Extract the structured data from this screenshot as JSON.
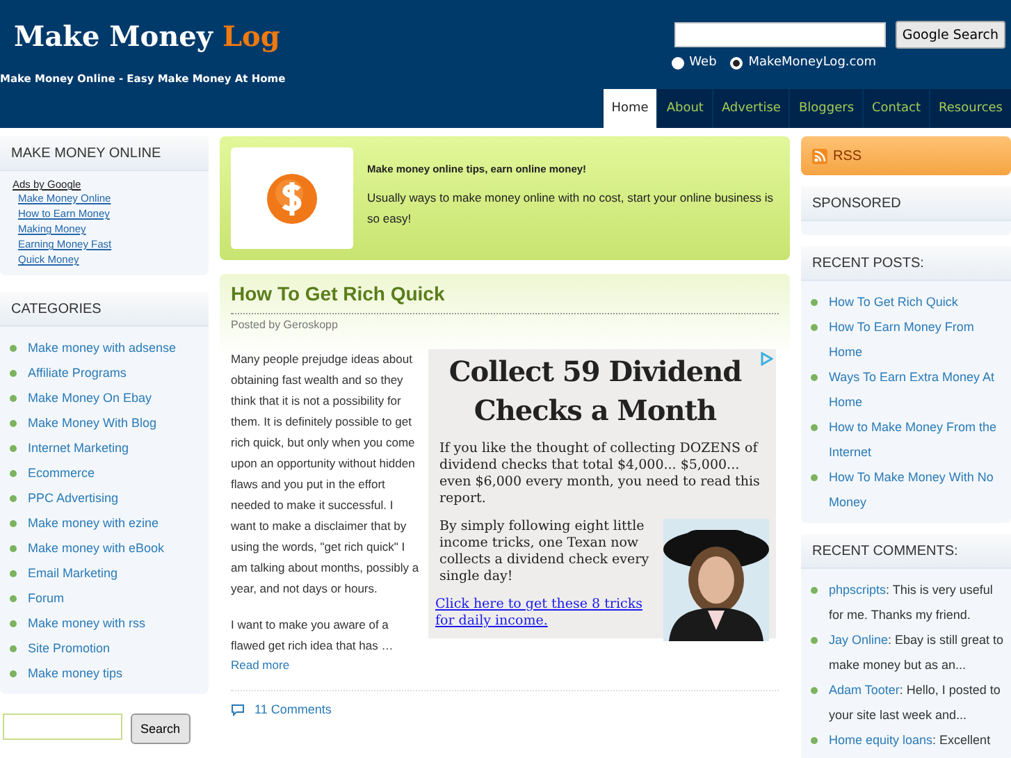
{
  "header": {
    "logo_main": "Make Money",
    "logo_accent": "Log",
    "tagline": "Make Money Online - Easy Make Money At Home",
    "search_button": "Google Search",
    "search_options": [
      {
        "label": "Web",
        "selected": false
      },
      {
        "label": "MakeMoneyLog.com",
        "selected": true
      }
    ]
  },
  "nav": [
    {
      "label": "Home",
      "selected": true
    },
    {
      "label": "About",
      "selected": false
    },
    {
      "label": "Advertise",
      "selected": false
    },
    {
      "label": "Bloggers",
      "selected": false
    },
    {
      "label": "Contact",
      "selected": false
    },
    {
      "label": "Resources",
      "selected": false
    }
  ],
  "left_sidebar": {
    "ads_title": "MAKE MONEY ONLINE",
    "ads_label": "Ads by Google",
    "ad_links": [
      "Make Money Online",
      "How to Earn Money",
      "Making Money",
      "Earning Money Fast",
      "Quick Money"
    ],
    "categories_title": "CATEGORIES",
    "categories": [
      "Make money with adsense",
      "Affiliate Programs",
      "Make Money On Ebay",
      "Make Money With Blog",
      "Internet Marketing",
      "Ecommerce",
      "PPC Advertising",
      "Make money with ezine",
      "Make money with eBook",
      "Email Marketing",
      "Forum",
      "Make money with rss",
      "Site Promotion",
      "Make money tips"
    ],
    "search_button": "Search"
  },
  "banner": {
    "title": "Make money online tips, earn online money!",
    "text": "Usually ways to make money online with no cost, start your online business is so easy!"
  },
  "post": {
    "title": "How To Get Rich Quick",
    "byline": "Posted by Geroskopp",
    "paragraphs": [
      "Many people prejudge ideas about obtaining fast wealth and so they think that it is not a possibility for them. It is definitely possible to get rich quick, but only when you come upon an opportunity without hidden flaws and you put in the effort needed to make it successful. I want to make a disclaimer that by using the words, \"get rich quick\" I am talking about months, possibly a year, and not days or hours.",
      "I want to make you aware of a flawed get rich idea that has …"
    ],
    "read_more": "Read more",
    "comments": "11 Comments",
    "ad": {
      "headline": "Collect 59 Dividend Checks a Month",
      "text": "If you like the thought of  collecting DOZENS of dividend checks that total $4,000... $5,000... even $6,000 every month, you need to read this report.",
      "text2": "By simply following eight little income tricks, one Texan now collects a dividend check every single day!",
      "link": "Click here to get these 8 tricks for daily income."
    }
  },
  "right_sidebar": {
    "rss": "RSS",
    "sponsored_title": "SPONSORED",
    "recent_posts_title": "RECENT POSTS:",
    "recent_posts": [
      "How To Get Rich Quick",
      "How To Earn Money From Home",
      "Ways To Earn Extra Money At Home",
      "How to Make Money From the Internet",
      "How To Make Money With No Money"
    ],
    "recent_comments_title": "RECENT COMMENTS:",
    "recent_comments": [
      {
        "author": "phpscripts",
        "text": ": This is very useful for me. Thanks my friend."
      },
      {
        "author": "Jay Online",
        "text": ": Ebay is still great to make money but as an..."
      },
      {
        "author": "Adam Tooter",
        "text": ": Hello, I posted to your site last week and..."
      },
      {
        "author": "Home equity loans",
        "text": ": Excellent"
      }
    ]
  }
}
